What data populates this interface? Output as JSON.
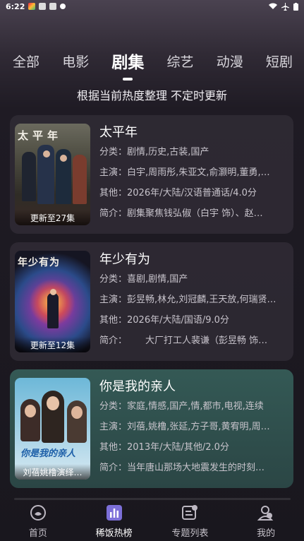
{
  "status_bar": {
    "time": "6:22"
  },
  "tabs": [
    {
      "label": "全部"
    },
    {
      "label": "电影"
    },
    {
      "label": "剧集",
      "active": true
    },
    {
      "label": "综艺"
    },
    {
      "label": "动漫"
    },
    {
      "label": "短剧"
    }
  ],
  "subtitle": "根据当前热度整理 不定时更新",
  "items": [
    {
      "title": "太平年",
      "poster_title": "太平年",
      "poster_tag": "更新至27集",
      "category_label": "分类：",
      "category": "剧情,历史,古装,国产",
      "cast_label": "主演：",
      "cast": "白宇,周雨彤,朱亚文,俞灏明,董勇,…",
      "other_label": "其他：",
      "other": "2026年/大陆/汉语普通话/4.0分",
      "intro_label": "简介：",
      "intro": "剧集聚焦钱弘俶（白宇 饰）、赵…"
    },
    {
      "title": "年少有为",
      "poster_title": "年少有为",
      "poster_tag": "更新至12集",
      "category_label": "分类：",
      "category": "喜剧,剧情,国产",
      "cast_label": "主演：",
      "cast": "彭昱畅,林允,刘冠麟,王天放,何瑞贤…",
      "other_label": "其他：",
      "other": "2026年/大陆/国语/9.0分",
      "intro_label": "简介：",
      "intro": "　　大厂打工人裴谦（彭昱畅 饰…"
    },
    {
      "title": "你是我的亲人",
      "poster_title": "你是我的亲人",
      "poster_tag": "刘蓓姚橹演绎…",
      "category_label": "分类：",
      "category": "家庭,情感,国产,情,都市,电视,连续",
      "cast_label": "主演：",
      "cast": "刘蓓,姚橹,张延,方子哥,黄宥明,周…",
      "other_label": "其他：",
      "other": "2013年/大陆/其他/2.0分",
      "intro_label": "简介：",
      "intro": "当年唐山那场大地震发生的时刻…"
    }
  ],
  "bottom_nav": [
    {
      "label": "首页",
      "icon": "home-icon"
    },
    {
      "label": "稀饭热榜",
      "icon": "chart-icon",
      "active": true
    },
    {
      "label": "专题列表",
      "icon": "list-icon"
    },
    {
      "label": "我的",
      "icon": "user-icon"
    }
  ],
  "colors": {
    "accent": "#ffffff",
    "teal_card": "#345955"
  }
}
